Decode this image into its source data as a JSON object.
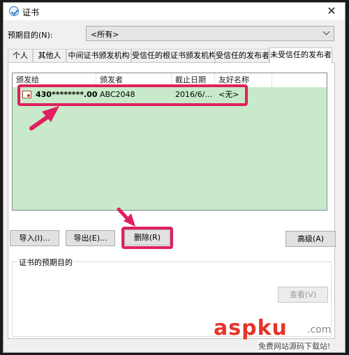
{
  "window": {
    "title": "证书",
    "close": "✕"
  },
  "purpose": {
    "label": "预期目的(N):",
    "value": "<所有>"
  },
  "tabs": [
    "个人",
    "其他人",
    "中间证书颁发机构",
    "受信任的根证书颁发机构",
    "受信任的发布者",
    "未受信任的发布者"
  ],
  "active_tab": "未受信任的发布者",
  "list": {
    "columns": [
      "颁发给",
      "颁发者",
      "截止日期",
      "友好名称"
    ],
    "rows": [
      {
        "issued_to": "430********.00 ...",
        "issued_by": "ABC2048",
        "expires": "2016/6/...",
        "friendly_name": "<无>"
      }
    ]
  },
  "buttons": {
    "import": "导入(I)...",
    "export": "导出(E)...",
    "remove": "删除(R)",
    "advanced": "高级(A)",
    "view": "查看(V)"
  },
  "group": {
    "label": "证书的预期目的"
  },
  "watermark": {
    "brand": "aspku",
    "suffix": ".com",
    "slogan": "免费网站源码下载站!"
  },
  "colors": {
    "highlight": "#e0205f",
    "list_bg": "#c8eaca",
    "accent": "#e0205f"
  }
}
